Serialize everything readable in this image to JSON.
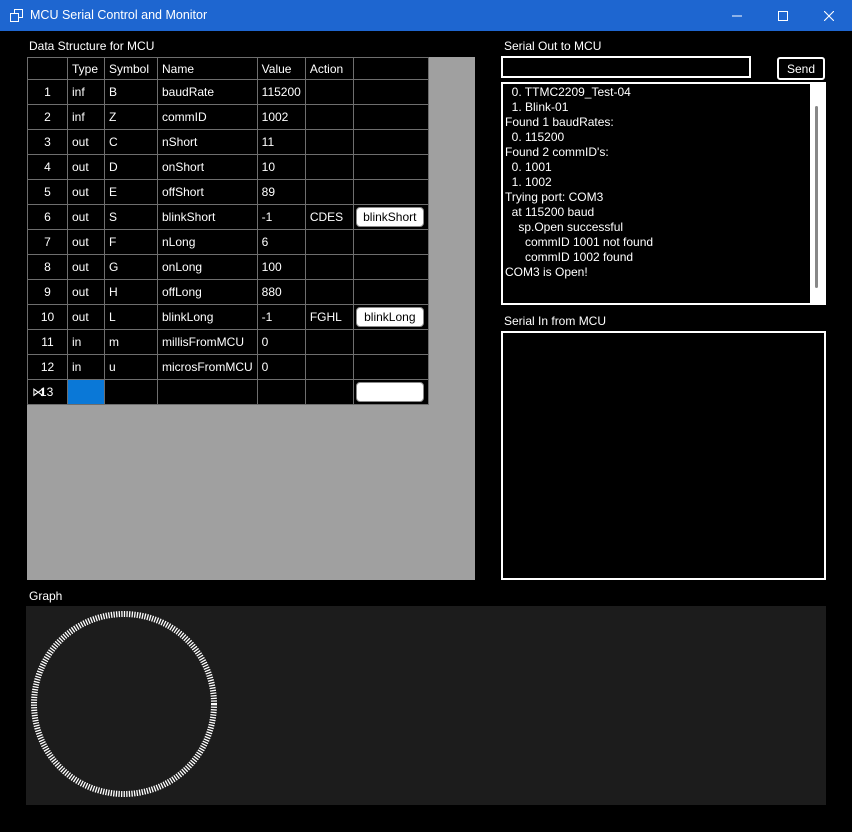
{
  "window": {
    "title": "MCU Serial Control and Monitor"
  },
  "labels": {
    "data_structure": "Data Structure for MCU",
    "serial_out": "Serial Out to MCU",
    "serial_in": "Serial In from MCU",
    "graph": "Graph"
  },
  "grid": {
    "columns": [
      "Type",
      "Symbol",
      "Name",
      "Value",
      "Action"
    ],
    "rows": [
      {
        "n": "1",
        "type": "inf",
        "symbol": "B",
        "name": "baudRate",
        "value": "115200",
        "action": "",
        "button": ""
      },
      {
        "n": "2",
        "type": "inf",
        "symbol": "Z",
        "name": "commID",
        "value": "1002",
        "action": "",
        "button": ""
      },
      {
        "n": "3",
        "type": "out",
        "symbol": "C",
        "name": "nShort",
        "value": "11",
        "action": "",
        "button": ""
      },
      {
        "n": "4",
        "type": "out",
        "symbol": "D",
        "name": "onShort",
        "value": "10",
        "action": "",
        "button": ""
      },
      {
        "n": "5",
        "type": "out",
        "symbol": "E",
        "name": "offShort",
        "value": "89",
        "action": "",
        "button": ""
      },
      {
        "n": "6",
        "type": "out",
        "symbol": "S",
        "name": "blinkShort",
        "value": "-1",
        "action": "CDES",
        "button": "blinkShort"
      },
      {
        "n": "7",
        "type": "out",
        "symbol": "F",
        "name": "nLong",
        "value": "6",
        "action": "",
        "button": ""
      },
      {
        "n": "8",
        "type": "out",
        "symbol": "G",
        "name": "onLong",
        "value": "100",
        "action": "",
        "button": ""
      },
      {
        "n": "9",
        "type": "out",
        "symbol": "H",
        "name": "offLong",
        "value": "880",
        "action": "",
        "button": ""
      },
      {
        "n": "10",
        "type": "out",
        "symbol": "L",
        "name": "blinkLong",
        "value": "-1",
        "action": "FGHL",
        "button": "blinkLong"
      },
      {
        "n": "11",
        "type": "in",
        "symbol": "m",
        "name": "millisFromMCU",
        "value": "0",
        "action": "",
        "button": ""
      },
      {
        "n": "12",
        "type": "in",
        "symbol": "u",
        "name": "microsFromMCU",
        "value": "0",
        "action": "",
        "button": ""
      }
    ],
    "new_row": {
      "n": "13",
      "marker": "⋈"
    }
  },
  "serial_out": {
    "input_value": "",
    "send_label": "Send",
    "log": [
      "  0. TTMC2209_Test-04",
      "  1. Blink-01",
      "Found 1 baudRates:",
      "  0. 115200",
      "Found 2 commID's:",
      "  0. 1001",
      "  1. 1002",
      "Trying port: COM3",
      "  at 115200 baud",
      "    sp.Open successful",
      "      commID 1001 not found",
      "      commID 1002 found",
      "COM3 is Open!"
    ]
  },
  "serial_in": {
    "log": []
  },
  "colors": {
    "titlebar": "#1e66d0",
    "selection": "#0a78d7",
    "grid_bg": "#a0a0a0",
    "graph_bg": "#1c1c1c"
  }
}
